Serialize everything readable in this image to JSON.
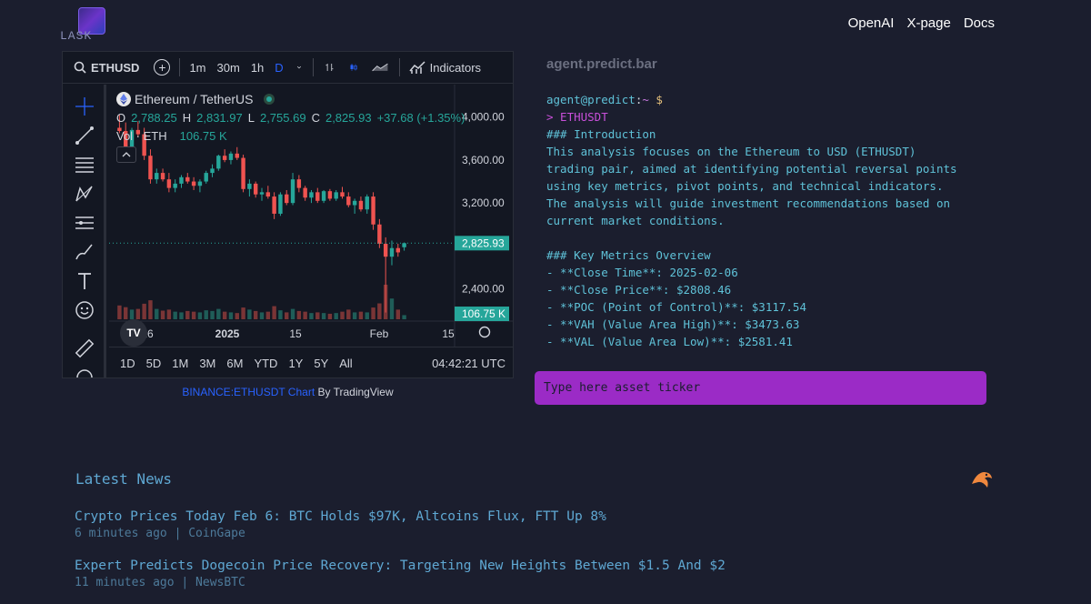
{
  "header": {
    "logo_text": "LASK",
    "nav": [
      "OpenAI",
      "X-page",
      "Docs"
    ]
  },
  "chart_widget": {
    "symbol": "ETHUSD",
    "intervals": [
      "1m",
      "30m",
      "1h",
      "D"
    ],
    "active_interval": "D",
    "indicators_label": "Indicators",
    "pair_name": "Ethereum / TetherUS",
    "ohlc": {
      "o_label": "O",
      "o": "2,788.25",
      "h_label": "H",
      "h": "2,831.97",
      "l_label": "L",
      "l": "2,755.69",
      "c_label": "C",
      "c": "2,825.93",
      "change": "+37.68 (+1.35%)"
    },
    "volume_label": "Vol · ETH",
    "volume_value": "106.75 K",
    "price_ticks": [
      "4,000.00",
      "3,600.00",
      "3,200.00",
      "2,400.00"
    ],
    "last_price": "2,825.93",
    "last_volume": "106.75 K",
    "time_ticks": [
      "16",
      "2025",
      "15",
      "Feb",
      "15"
    ],
    "ranges": [
      "1D",
      "5D",
      "1M",
      "3M",
      "6M",
      "YTD",
      "1Y",
      "5Y",
      "All"
    ],
    "clock": "04:42:21 UTC",
    "caption_link": "BINANCE:ETHUSDT Chart",
    "caption_rest": " By TradingView",
    "tv_logo": "TV",
    "colors": {
      "up": "#26a69a",
      "down": "#ef5350",
      "accent": "#2962ff"
    }
  },
  "chart_data": {
    "type": "candlestick",
    "ylim": [
      2100,
      4150
    ],
    "candles": [
      {
        "o": 3900,
        "h": 4020,
        "l": 3850,
        "c": 3870
      },
      {
        "o": 3870,
        "h": 3950,
        "l": 3700,
        "c": 3720
      },
      {
        "o": 3720,
        "h": 3900,
        "l": 3680,
        "c": 3880
      },
      {
        "o": 3880,
        "h": 3960,
        "l": 3820,
        "c": 3840
      },
      {
        "o": 3840,
        "h": 3900,
        "l": 3600,
        "c": 3640
      },
      {
        "o": 3640,
        "h": 3700,
        "l": 3380,
        "c": 3420
      },
      {
        "o": 3420,
        "h": 3520,
        "l": 3380,
        "c": 3480
      },
      {
        "o": 3480,
        "h": 3520,
        "l": 3400,
        "c": 3420
      },
      {
        "o": 3420,
        "h": 3480,
        "l": 3300,
        "c": 3340
      },
      {
        "o": 3340,
        "h": 3420,
        "l": 3300,
        "c": 3380
      },
      {
        "o": 3380,
        "h": 3460,
        "l": 3340,
        "c": 3440
      },
      {
        "o": 3440,
        "h": 3480,
        "l": 3380,
        "c": 3400
      },
      {
        "o": 3400,
        "h": 3440,
        "l": 3320,
        "c": 3360
      },
      {
        "o": 3360,
        "h": 3420,
        "l": 3300,
        "c": 3400
      },
      {
        "o": 3400,
        "h": 3500,
        "l": 3380,
        "c": 3480
      },
      {
        "o": 3480,
        "h": 3560,
        "l": 3440,
        "c": 3520
      },
      {
        "o": 3520,
        "h": 3650,
        "l": 3500,
        "c": 3640
      },
      {
        "o": 3640,
        "h": 3700,
        "l": 3580,
        "c": 3600
      },
      {
        "o": 3600,
        "h": 3680,
        "l": 3560,
        "c": 3660
      },
      {
        "o": 3660,
        "h": 3720,
        "l": 3600,
        "c": 3620
      },
      {
        "o": 3620,
        "h": 3650,
        "l": 3300,
        "c": 3330
      },
      {
        "o": 3330,
        "h": 3420,
        "l": 3260,
        "c": 3380
      },
      {
        "o": 3380,
        "h": 3400,
        "l": 3250,
        "c": 3280
      },
      {
        "o": 3280,
        "h": 3340,
        "l": 3220,
        "c": 3300
      },
      {
        "o": 3300,
        "h": 3360,
        "l": 3240,
        "c": 3260
      },
      {
        "o": 3260,
        "h": 3300,
        "l": 3050,
        "c": 3100
      },
      {
        "o": 3100,
        "h": 3300,
        "l": 3080,
        "c": 3280
      },
      {
        "o": 3280,
        "h": 3320,
        "l": 3180,
        "c": 3200
      },
      {
        "o": 3200,
        "h": 3480,
        "l": 3180,
        "c": 3420
      },
      {
        "o": 3420,
        "h": 3460,
        "l": 3300,
        "c": 3340
      },
      {
        "o": 3340,
        "h": 3360,
        "l": 3220,
        "c": 3250
      },
      {
        "o": 3250,
        "h": 3320,
        "l": 3200,
        "c": 3300
      },
      {
        "o": 3300,
        "h": 3340,
        "l": 3200,
        "c": 3220
      },
      {
        "o": 3220,
        "h": 3320,
        "l": 3200,
        "c": 3310
      },
      {
        "o": 3310,
        "h": 3330,
        "l": 3220,
        "c": 3240
      },
      {
        "o": 3240,
        "h": 3320,
        "l": 3220,
        "c": 3300
      },
      {
        "o": 3300,
        "h": 3350,
        "l": 3240,
        "c": 3260
      },
      {
        "o": 3260,
        "h": 3300,
        "l": 3160,
        "c": 3180
      },
      {
        "o": 3180,
        "h": 3240,
        "l": 3100,
        "c": 3220
      },
      {
        "o": 3220,
        "h": 3260,
        "l": 3120,
        "c": 3140
      },
      {
        "o": 3140,
        "h": 3280,
        "l": 3100,
        "c": 3260
      },
      {
        "o": 3260,
        "h": 3300,
        "l": 2950,
        "c": 3000
      },
      {
        "o": 3000,
        "h": 3050,
        "l": 2780,
        "c": 2820
      },
      {
        "o": 2820,
        "h": 2880,
        "l": 2180,
        "c": 2700
      },
      {
        "o": 2700,
        "h": 2850,
        "l": 2620,
        "c": 2780
      },
      {
        "o": 2780,
        "h": 2820,
        "l": 2700,
        "c": 2740
      },
      {
        "o": 2788,
        "h": 2832,
        "l": 2756,
        "c": 2826
      }
    ],
    "volumes": [
      40,
      35,
      28,
      30,
      45,
      55,
      30,
      25,
      28,
      22,
      20,
      24,
      22,
      20,
      26,
      24,
      30,
      22,
      20,
      18,
      34,
      28,
      24,
      20,
      22,
      38,
      26,
      20,
      30,
      24,
      22,
      18,
      20,
      18,
      16,
      18,
      22,
      28,
      20,
      22,
      20,
      34,
      46,
      100,
      60,
      28,
      12
    ]
  },
  "terminal": {
    "title": "agent.predict.bar",
    "prompt_user": "agent@predict",
    "prompt_colon": ":",
    "prompt_tilde": "~",
    "prompt_dollar": " $",
    "command": "> ETHUSDT",
    "lines": [
      "### Introduction",
      "This analysis focuses on the Ethereum to USD (ETHUSDT)",
      "trading pair, aimed at identifying potential reversal points",
      "using key metrics, pivot points, and technical indicators.",
      "The analysis will guide investment recommendations based on",
      "current market conditions.",
      "",
      "### Key Metrics Overview",
      "- **Close Time**: 2025-02-06",
      "- **Close Price**: $2808.46",
      "- **POC (Point of Control)**: $3117.54",
      "- **VAH (Value Area High)**: $3473.63",
      "- **VAL (Value Area Low)**: $2581.41"
    ],
    "ticker_placeholder": "Type here asset ticker",
    "ticker_color": "#9b2bc6"
  },
  "news": {
    "title": "Latest News",
    "items": [
      {
        "headline": "Crypto Prices Today Feb 6: BTC Holds $97K, Altcoins Flux, FTT Up 8%",
        "meta": "6 minutes ago | CoinGape"
      },
      {
        "headline": "Expert Predicts Dogecoin Price Recovery: Targeting New Heights Between $1.5 And $2",
        "meta": "11 minutes ago | NewsBTC"
      }
    ]
  }
}
